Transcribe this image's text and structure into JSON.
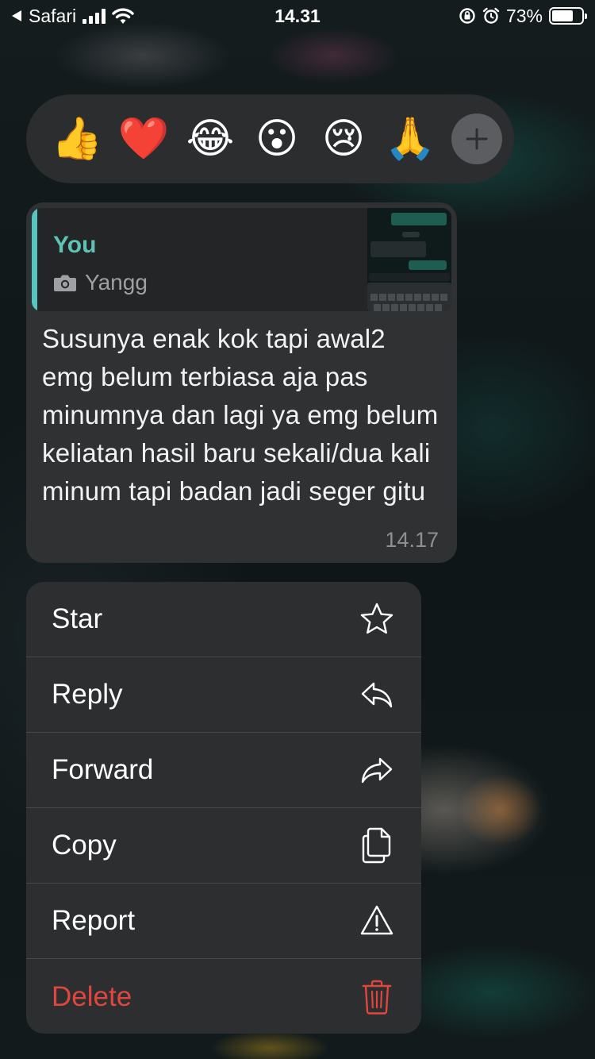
{
  "status_bar": {
    "back_app": "Safari",
    "time": "14.31",
    "battery": "73%",
    "battery_level": 0.73
  },
  "reactions": [
    {
      "name": "thumbs-up",
      "glyph": "👍"
    },
    {
      "name": "red-heart",
      "glyph": "❤️"
    },
    {
      "name": "tears-of-joy",
      "glyph": "😂"
    },
    {
      "name": "surprised",
      "glyph": "😮"
    },
    {
      "name": "crying",
      "glyph": "😢"
    },
    {
      "name": "folded-hands",
      "glyph": "🙏"
    }
  ],
  "message": {
    "quoted_sender": "You",
    "quoted_text": "Yangg",
    "quoted_icon": "camera-icon",
    "text": "Susunya enak kok tapi awal2 emg belum terbiasa aja pas minumnya dan lagi ya emg belum keliatan hasil baru sekali/dua kali minum tapi badan jadi seger gitu",
    "time": "14.17"
  },
  "menu": {
    "items": [
      {
        "label": "Star",
        "icon": "star-icon"
      },
      {
        "label": "Reply",
        "icon": "reply-icon"
      },
      {
        "label": "Forward",
        "icon": "forward-icon"
      },
      {
        "label": "Copy",
        "icon": "copy-icon"
      },
      {
        "label": "Report",
        "icon": "report-icon"
      },
      {
        "label": "Delete",
        "icon": "trash-icon",
        "danger": true
      }
    ]
  },
  "colors": {
    "accent_quote": "#56c5c0",
    "danger": "#e0463d",
    "bubble": "#2f3133",
    "menu": "#2c2e30"
  }
}
